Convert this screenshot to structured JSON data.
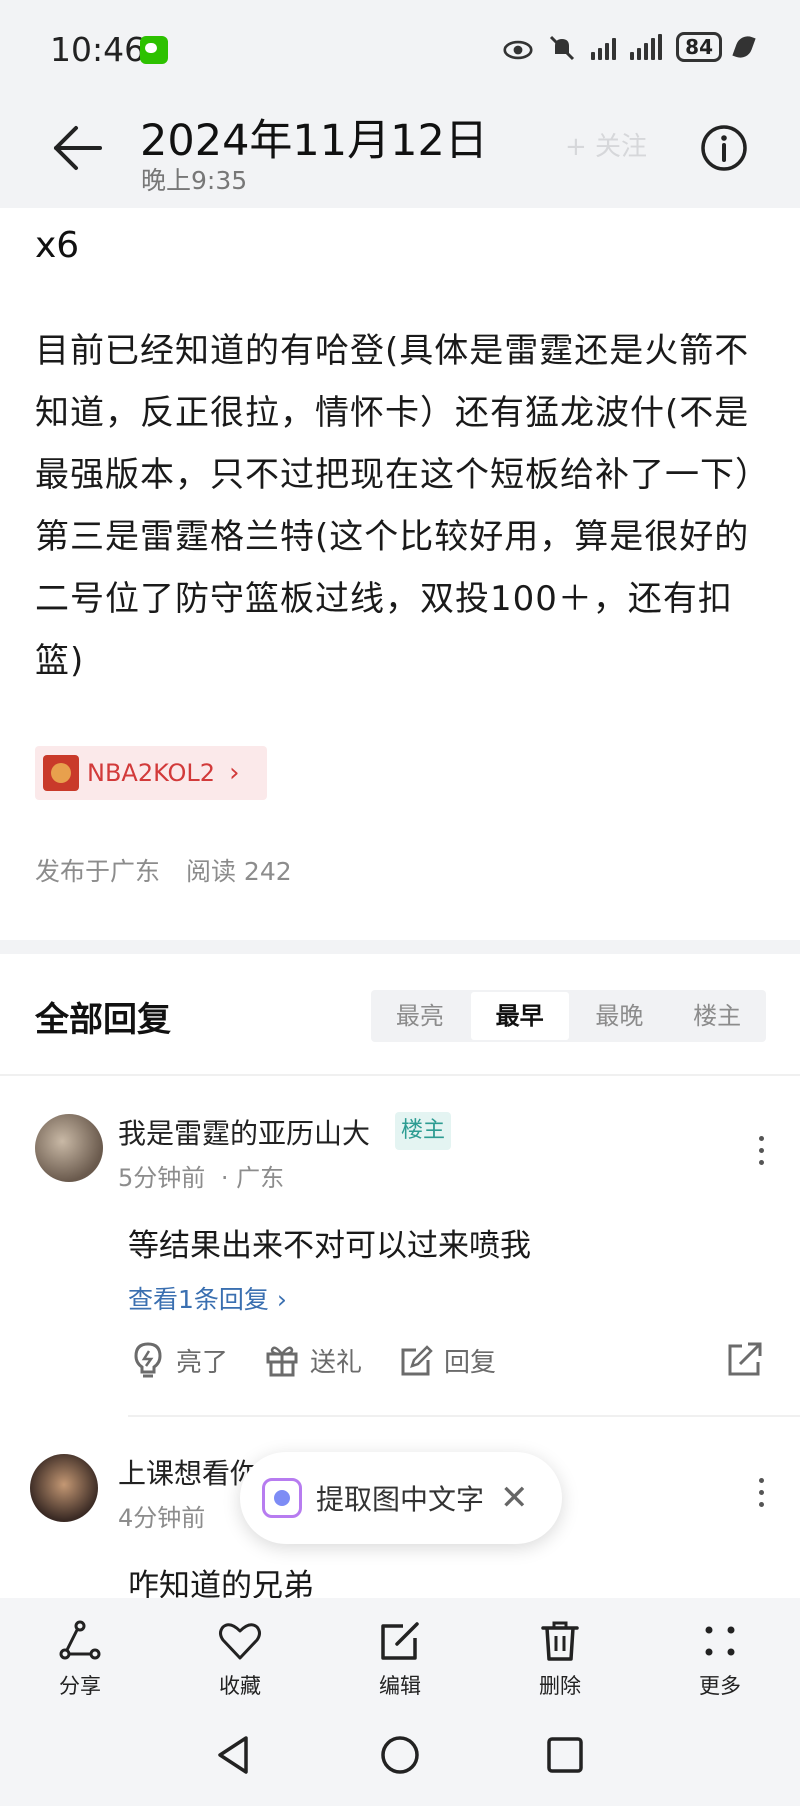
{
  "status_bar": {
    "time": "10:46",
    "battery": "84"
  },
  "header": {
    "date_title": "2024年11月12日",
    "time_subtitle": "晚上9:35"
  },
  "post": {
    "heading": "x6",
    "body": "目前已经知道的有哈登(具体是雷霆还是火箭不知道，反正很拉，情怀卡）还有猛龙波什(不是最强版本，只不过把现在这个短板给补了一下）第三是雷霆格兰特(这个比较好用，算是很好的二号位了防守篮板过线，双投100＋，还有扣篮)",
    "tag": "NBA2KOL2",
    "location": "发布于广东",
    "reads": "阅读 242"
  },
  "replies": {
    "title": "全部回复",
    "sort_options": [
      "最亮",
      "最早",
      "最晚",
      "楼主"
    ],
    "sort_active": "最早"
  },
  "comments": [
    {
      "user": "我是雷霆的亚历山大",
      "badge": "楼主",
      "time": "5分钟前",
      "region": "· 广东",
      "text": "等结果出来不对可以过来喷我",
      "view_replies": "查看1条回复 ›",
      "actions": {
        "like": "亮了",
        "gift": "送礼",
        "reply": "回复"
      }
    },
    {
      "user": "上课想看你",
      "time": "4分钟前",
      "text": "咋知道的兄弟"
    }
  ],
  "ocr_popup": {
    "label": "提取图中文字"
  },
  "toolbar": [
    "分享",
    "收藏",
    "编辑",
    "删除",
    "更多"
  ],
  "ghost_texts": {
    "follow": "+ 关注"
  }
}
